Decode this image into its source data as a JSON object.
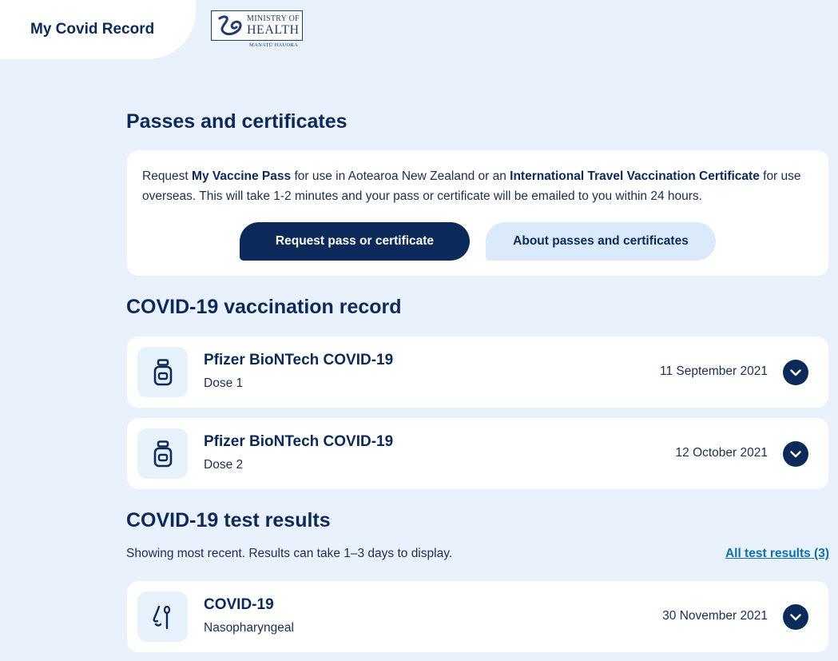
{
  "header": {
    "app_title": "My Covid Record",
    "logo": {
      "line1": "MINISTRY OF",
      "line2": "HEALTH",
      "subtitle": "MANATŪ HAUORA"
    }
  },
  "passes": {
    "heading": "Passes and certificates",
    "text_parts": {
      "t1": "Request ",
      "b1": "My Vaccine Pass",
      "t2": " for use in Aotearoa New Zealand or an ",
      "b2": "International Travel Vaccination Certificate",
      "t3": " for use overseas. This will take 1-2 minutes and your pass or certificate will be emailed to you within 24 hours."
    },
    "primary_button": "Request pass or certificate",
    "secondary_button": "About passes and certificates"
  },
  "vaccination": {
    "heading": "COVID-19 vaccination record",
    "records": [
      {
        "title": "Pfizer BioNTech COVID-19",
        "subtitle": "Dose 1",
        "date": "11 September 2021",
        "icon": "vaccine-vial-icon"
      },
      {
        "title": "Pfizer BioNTech COVID-19",
        "subtitle": "Dose 2",
        "date": "12 October 2021",
        "icon": "vaccine-vial-icon"
      }
    ]
  },
  "tests": {
    "heading": "COVID-19 test results",
    "note": "Showing most recent. Results can take 1–3 days to display.",
    "all_results_link": "All test results (3)",
    "records": [
      {
        "title": "COVID-19",
        "subtitle": "Nasopharyngeal",
        "date": "30 November 2021",
        "icon": "nasal-swab-icon"
      }
    ]
  },
  "colors": {
    "navy": "#0b2a5a",
    "background": "#e9f2fc",
    "light_blue": "#dbeafb",
    "link": "#0b6fb5"
  }
}
